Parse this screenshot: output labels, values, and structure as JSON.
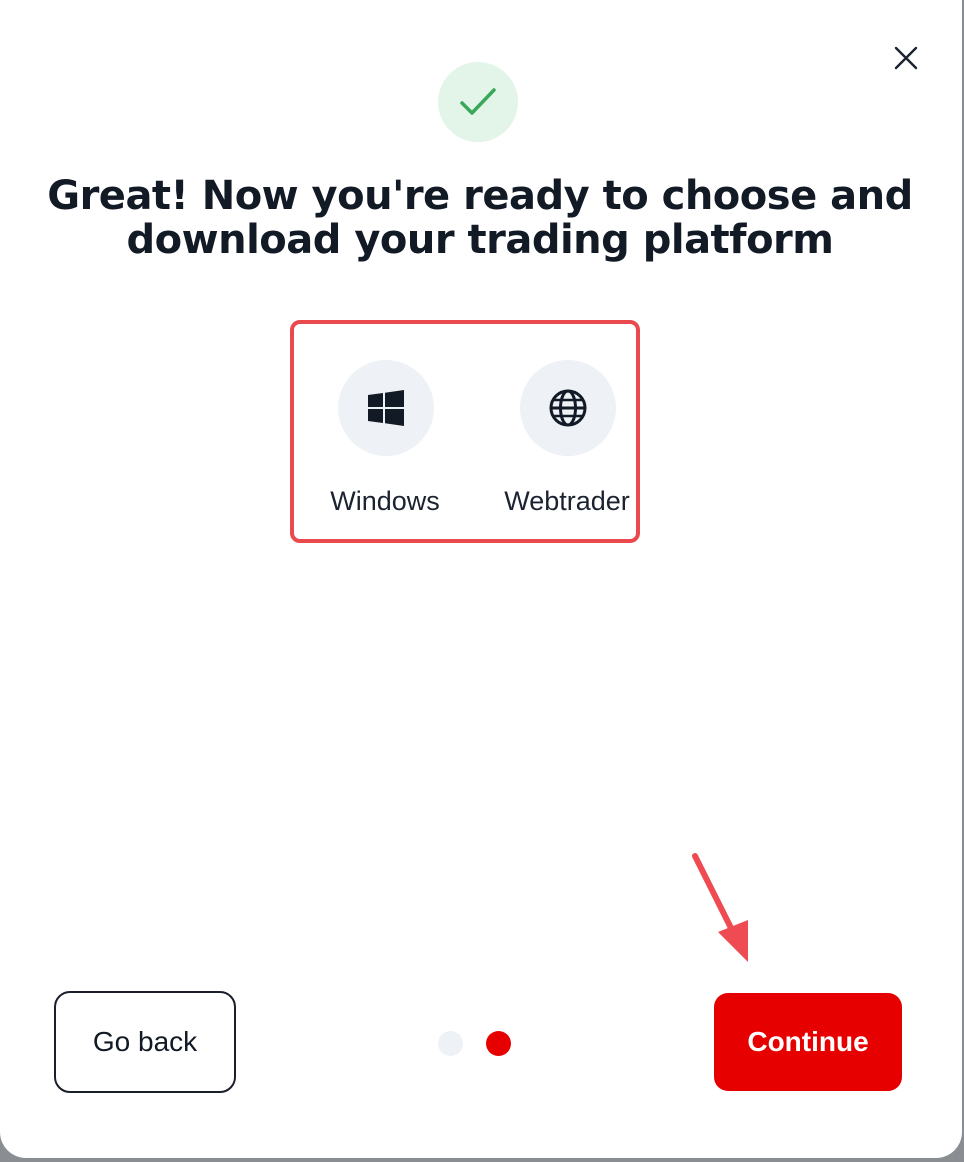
{
  "dialog": {
    "title": "Great! Now you're ready to choose and download your trading platform",
    "success_icon": "check-icon",
    "close_icon": "close-icon"
  },
  "platforms": [
    {
      "label": "Windows",
      "icon": "windows-icon"
    },
    {
      "label": "Webtrader",
      "icon": "globe-icon"
    }
  ],
  "footer": {
    "go_back_label": "Go back",
    "continue_label": "Continue",
    "step_total": 2,
    "step_current": 2
  },
  "colors": {
    "accent": "#e60000",
    "success_bg": "#e3f4e8",
    "success_check": "#3aa85a",
    "highlight_border": "#ea4a4e",
    "dot_inactive": "#eef1f6",
    "icon_bg": "#eef1f6"
  }
}
